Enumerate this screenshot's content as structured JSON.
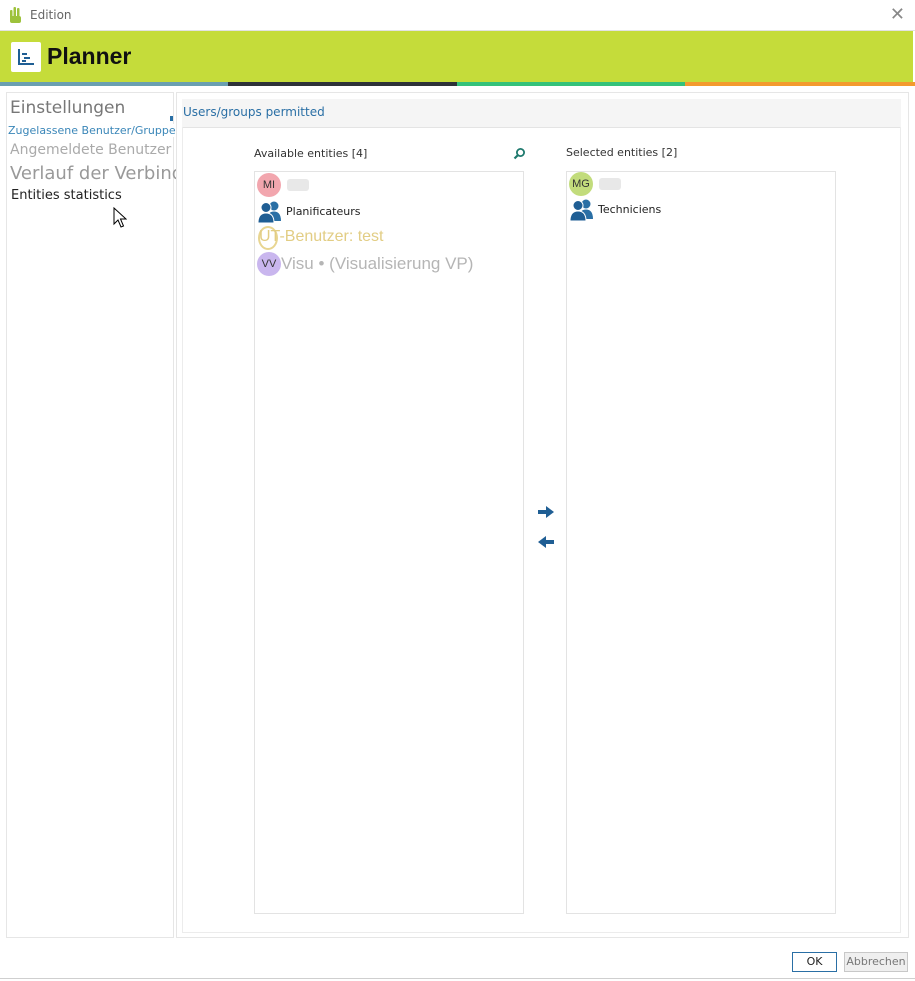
{
  "window": {
    "title": "Edition",
    "close_glyph": "✕"
  },
  "header": {
    "title": "Planner",
    "bg_color": "#c5dc3a"
  },
  "sidebar": {
    "items": [
      {
        "label": "Einstellungen"
      },
      {
        "label": "Zugelassene Benutzer/Gruppen"
      },
      {
        "label": "Angemeldete Benutzer anzeigen"
      },
      {
        "label": "Verlauf der Verbindung"
      },
      {
        "label": "Entities statistics"
      }
    ]
  },
  "section": {
    "title": "Users/groups permitted"
  },
  "available": {
    "label": "Available entities [4]",
    "items": [
      {
        "initials": "MI",
        "color": "#f2a6ae",
        "type": "user",
        "text": ""
      },
      {
        "type": "group",
        "text": "Planificateurs"
      },
      {
        "initials": "UT",
        "text": "UT-Benutzer: test",
        "color": "#e5cf84"
      },
      {
        "initials": "VV",
        "color": "#c9b6ee",
        "text": "Visu • (Visualisierung VP)"
      }
    ]
  },
  "selected": {
    "label": "Selected entities [2]",
    "items": [
      {
        "initials": "MG",
        "color": "#c2dc7c",
        "type": "user",
        "text": ""
      },
      {
        "type": "group",
        "text": "Techniciens"
      }
    ]
  },
  "footer": {
    "ok_label": "OK",
    "cancel_label": "Abbrechen"
  },
  "colors": {
    "accent": "#2a6fa5",
    "icon_blue": "#1f5e94"
  }
}
